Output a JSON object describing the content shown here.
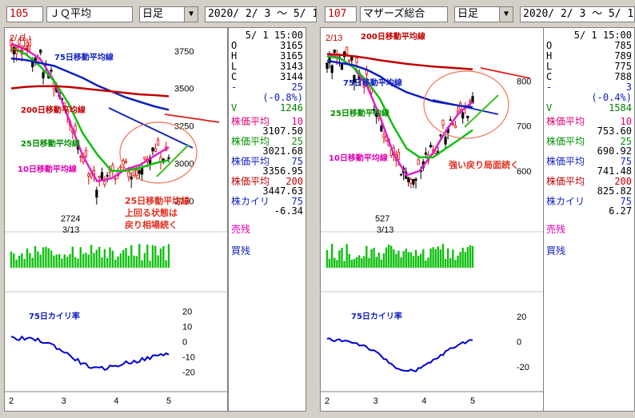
{
  "panels": [
    {
      "code": "105",
      "name": "ＪＱ平均",
      "period": "日足",
      "range": "2020/ 2/ 3 ～  5/ 1",
      "chart_start_label": "2/ 6",
      "chart_start_value": "3824",
      "low_value": "2724",
      "low_date": "3/13",
      "ma_labels": {
        "ma75": "75日移動平均線",
        "ma200": "200日移動平均線",
        "ma25": "25日移動平均線",
        "ma10": "10日移動平均線"
      },
      "price_ticks": [
        "3750",
        "3500",
        "3250",
        "3000",
        "2750"
      ],
      "kairi_title": "75日カイリ率",
      "kairi_ticks": [
        "20",
        "10",
        "0",
        "-10",
        "-20"
      ],
      "xaxis": [
        "2",
        "3",
        "4",
        "5"
      ],
      "comment": [
        "25日移動平均線",
        "上回る状態は",
        "戻り相場続く"
      ],
      "info": {
        "datetime": "5/ 1 15:00",
        "ohlcv": [
          {
            "k": "O",
            "v": "3165"
          },
          {
            "k": "H",
            "v": "3165"
          },
          {
            "k": "L",
            "v": "3143"
          },
          {
            "k": "C",
            "v": "3144"
          },
          {
            "k": "-",
            "v": "25"
          },
          {
            "k": "",
            "v": "(-0.8%)"
          },
          {
            "k": "V",
            "v": "1246"
          }
        ],
        "ma": [
          {
            "label": "株価平均",
            "period": "10",
            "value": "3107.50",
            "color": "#e0007a"
          },
          {
            "label": "株価平均",
            "period": "25",
            "value": "3021.68",
            "color": "#009000"
          },
          {
            "label": "株価平均",
            "period": "75",
            "value": "3356.95",
            "color": "#1020c0"
          },
          {
            "label": "株価平均",
            "period": "200",
            "value": "3447.63",
            "color": "#c00000"
          }
        ],
        "kairi_label": "株カイリ",
        "kairi_period": "75",
        "kairi_value": "-6.34",
        "sell": "売残",
        "buy": "買残"
      }
    },
    {
      "code": "107",
      "name": "マザーズ総合",
      "period": "日足",
      "range": "2020/ 2/ 3 ～  5/ 1",
      "chart_start_label": "2/13",
      "chart_start_value": "",
      "low_value": "527",
      "low_date": "3/13",
      "ma_labels": {
        "ma75": "75日移動平均線",
        "ma200": "200日移動平均線",
        "ma25": "25日移動平均線",
        "ma10": "10日移動平均線"
      },
      "price_ticks": [
        "800",
        "700",
        "600"
      ],
      "kairi_title": "75日カイリ率",
      "kairi_ticks": [
        "20",
        "0",
        "-20"
      ],
      "xaxis": [
        "2",
        "3",
        "4",
        "5"
      ],
      "comment": [
        "強い戻り局面続く"
      ],
      "info": {
        "datetime": "5/ 1 15:00",
        "ohlcv": [
          {
            "k": "O",
            "v": "785"
          },
          {
            "k": "H",
            "v": "789"
          },
          {
            "k": "L",
            "v": "775"
          },
          {
            "k": "C",
            "v": "788"
          },
          {
            "k": "-",
            "v": "3"
          },
          {
            "k": "",
            "v": "(-0.4%)"
          },
          {
            "k": "V",
            "v": "1584"
          }
        ],
        "ma": [
          {
            "label": "株価平均",
            "period": "10",
            "value": "753.60",
            "color": "#e0007a"
          },
          {
            "label": "株価平均",
            "period": "25",
            "value": "690.92",
            "color": "#009000"
          },
          {
            "label": "株価平均",
            "period": "75",
            "value": "741.48",
            "color": "#1020c0"
          },
          {
            "label": "株価平均",
            "period": "200",
            "value": "825.82",
            "color": "#c00000"
          }
        ],
        "kairi_label": "株カイリ",
        "kairi_period": "75",
        "kairi_value": "6.27",
        "sell": "売残",
        "buy": "買残"
      }
    }
  ],
  "colors": {
    "ma10": "#e020c8",
    "ma25": "#10c010",
    "ma75": "#1020c0",
    "ma200": "#c00000",
    "candle_up": "#e00000",
    "candle_down": "#000000",
    "volume": "#10c010",
    "kairi": "#0000d0",
    "annotation": "#e03020"
  },
  "chart_data": [
    {
      "type": "line",
      "title": "ＪＱ平均",
      "x": [
        "2",
        "3",
        "4",
        "5"
      ],
      "ylim": [
        2650,
        3850
      ],
      "series": [
        {
          "name": "10日移動平均線",
          "values": [
            3800,
            3760,
            3700,
            3550,
            3300,
            3050,
            2880,
            2900,
            2960,
            2990,
            3050,
            3107.5
          ]
        },
        {
          "name": "25日移動平均線",
          "values": [
            3770,
            3730,
            3650,
            3550,
            3400,
            3200,
            3060,
            2950,
            2950,
            2970,
            3000,
            3021.68
          ]
        },
        {
          "name": "75日移動平均線",
          "values": [
            3700,
            3690,
            3670,
            3650,
            3610,
            3570,
            3520,
            3480,
            3440,
            3410,
            3380,
            3356.95
          ]
        },
        {
          "name": "200日移動平均線",
          "values": [
            3500,
            3510,
            3515,
            3515,
            3510,
            3500,
            3490,
            3480,
            3470,
            3460,
            3455,
            3447.63
          ]
        }
      ],
      "annotations": [
        "2724",
        "3/13",
        "3824"
      ]
    },
    {
      "type": "line",
      "title": "マザーズ総合",
      "x": [
        "2",
        "3",
        "4",
        "5"
      ],
      "ylim": [
        500,
        900
      ],
      "series": [
        {
          "name": "10日移動平均線",
          "values": [
            860,
            850,
            830,
            790,
            720,
            640,
            590,
            600,
            640,
            690,
            730,
            753.6
          ]
        },
        {
          "name": "25日移動平均線",
          "values": [
            855,
            850,
            830,
            800,
            760,
            700,
            650,
            630,
            630,
            650,
            670,
            690.92
          ]
        },
        {
          "name": "75日移動平均線",
          "values": [
            845,
            840,
            835,
            825,
            810,
            790,
            775,
            765,
            755,
            750,
            745,
            741.48
          ]
        },
        {
          "name": "200日移動平均線",
          "values": [
            860,
            858,
            855,
            851,
            846,
            842,
            838,
            835,
            832,
            830,
            828,
            825.82
          ]
        }
      ],
      "annotations": [
        "527",
        "3/13"
      ]
    }
  ]
}
